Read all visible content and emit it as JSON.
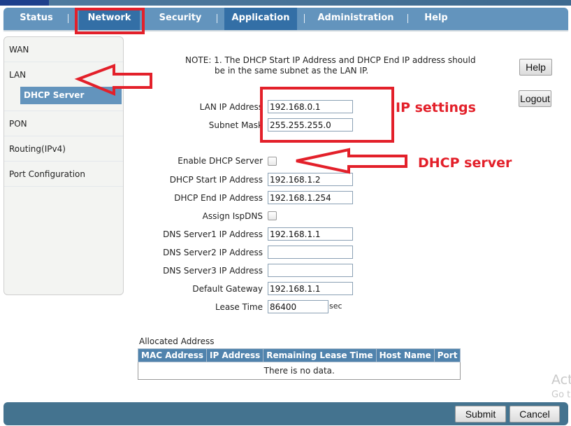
{
  "nav": {
    "items": [
      {
        "label": "Status",
        "active": false
      },
      {
        "label": "Network",
        "active": false,
        "highlighted": true
      },
      {
        "label": "Security",
        "active": false
      },
      {
        "label": "Application",
        "active": true
      },
      {
        "label": "Administration",
        "active": false
      },
      {
        "label": "Help",
        "active": false
      }
    ]
  },
  "sidebar": {
    "items": [
      {
        "label": "WAN"
      },
      {
        "label": "LAN"
      },
      {
        "label": "PON"
      },
      {
        "label": "Routing(IPv4)"
      },
      {
        "label": "Port Configuration"
      }
    ],
    "sub_items": [
      {
        "label": "DHCP Server",
        "selected": true
      }
    ]
  },
  "note": {
    "line1": "NOTE: 1. The DHCP Start IP Address and DHCP End IP address should",
    "line2": "be in the same subnet as the LAN IP."
  },
  "buttons": {
    "help": "Help",
    "logout": "Logout",
    "submit": "Submit",
    "cancel": "Cancel"
  },
  "form": {
    "lan_ip": {
      "label": "LAN IP Address",
      "value": "192.168.0.1"
    },
    "subnet_mask": {
      "label": "Subnet Mask",
      "value": "255.255.255.0"
    },
    "enable_dhcp": {
      "label": "Enable DHCP Server",
      "checked": false
    },
    "dhcp_start": {
      "label": "DHCP Start IP Address",
      "value": "192.168.1.2"
    },
    "dhcp_end": {
      "label": "DHCP End IP Address",
      "value": "192.168.1.254"
    },
    "assign_isp_dns": {
      "label": "Assign IspDNS",
      "checked": false
    },
    "dns1": {
      "label": "DNS Server1 IP Address",
      "value": "192.168.1.1"
    },
    "dns2": {
      "label": "DNS Server2 IP Address",
      "value": ""
    },
    "dns3": {
      "label": "DNS Server3 IP Address",
      "value": ""
    },
    "gateway": {
      "label": "Default Gateway",
      "value": "192.168.1.1"
    },
    "lease_time": {
      "label": "Lease Time",
      "value": "86400",
      "unit": "sec"
    }
  },
  "allocated": {
    "title": "Allocated Address",
    "columns": [
      "MAC Address",
      "IP Address",
      "Remaining Lease Time",
      "Host Name",
      "Port"
    ],
    "empty_text": "There is no data."
  },
  "annotations": {
    "ip_settings": "IP settings",
    "dhcp_server": "DHCP server",
    "color": "#e3202a"
  },
  "watermark": {
    "line1": "Act",
    "line2": "Go t"
  }
}
